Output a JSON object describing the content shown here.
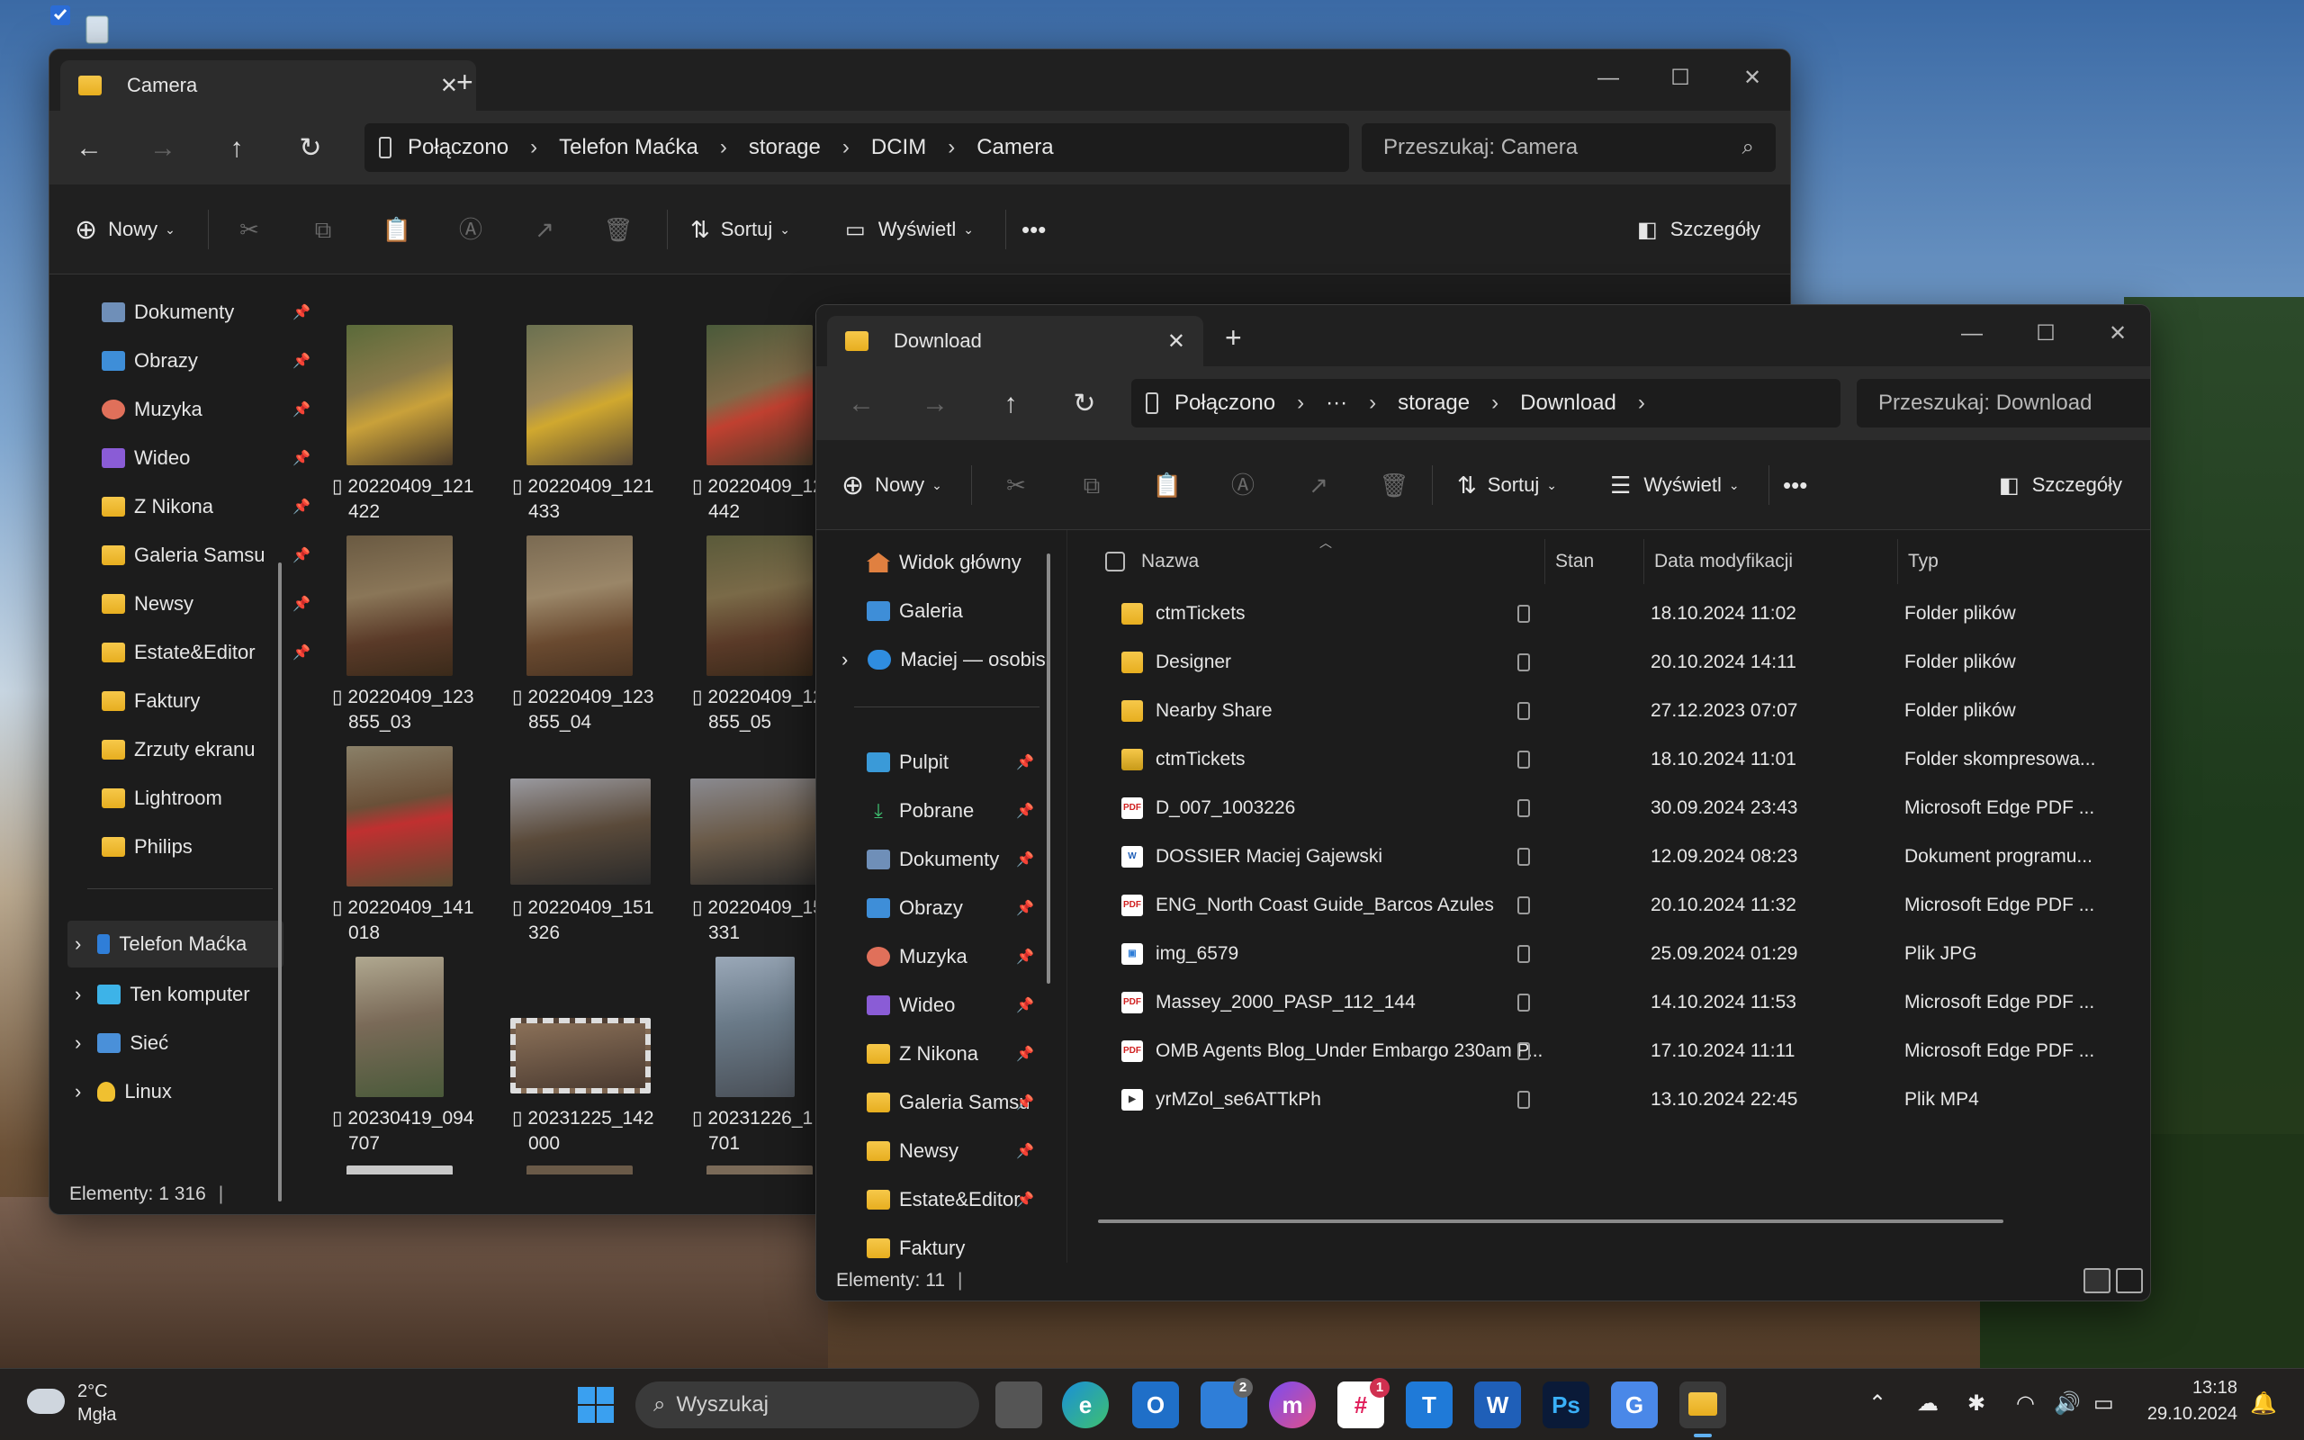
{
  "desktop": {
    "recycle_icon": "recycle-bin-icon"
  },
  "camera_window": {
    "tab_title": "Camera",
    "path": [
      "Połączono",
      "Telefon Maćka",
      "storage",
      "DCIM",
      "Camera"
    ],
    "search_placeholder": "Przeszukaj: Camera",
    "toolbar": {
      "new": "Nowy",
      "sort": "Sortuj",
      "view": "Wyświetl",
      "details": "Szczegóły",
      "more": "•••"
    },
    "sidebar": [
      {
        "label": "Dokumenty",
        "pinned": true
      },
      {
        "label": "Obrazy",
        "pinned": true
      },
      {
        "label": "Muzyka",
        "pinned": true
      },
      {
        "label": "Wideo",
        "pinned": true
      },
      {
        "label": "Z Nikona",
        "pinned": true
      },
      {
        "label": "Galeria Samsu",
        "pinned": true
      },
      {
        "label": "Newsy",
        "pinned": true
      },
      {
        "label": "Estate&Editor",
        "pinned": true
      },
      {
        "label": "Faktury",
        "pinned": false
      },
      {
        "label": "Zrzuty ekranu",
        "pinned": false
      },
      {
        "label": "Lightroom",
        "pinned": false
      },
      {
        "label": "Philips",
        "pinned": false
      }
    ],
    "sidebar_tree": [
      {
        "label": "Telefon Maćka"
      },
      {
        "label": "Ten komputer"
      },
      {
        "label": "Sieć"
      },
      {
        "label": "Linux"
      }
    ],
    "thumbnails": [
      {
        "l1": "20220409_121",
        "l2": "422"
      },
      {
        "l1": "20220409_121",
        "l2": "433"
      },
      {
        "l1": "20220409_12",
        "l2": "442"
      },
      {
        "l1": "20220409_123",
        "l2": "855_03"
      },
      {
        "l1": "20220409_123",
        "l2": "855_04"
      },
      {
        "l1": "20220409_12",
        "l2": "855_05"
      },
      {
        "l1": "20220409_141",
        "l2": "018"
      },
      {
        "l1": "20220409_151",
        "l2": "326"
      },
      {
        "l1": "20220409_15",
        "l2": "331"
      },
      {
        "l1": "20230419_094",
        "l2": "707"
      },
      {
        "l1": "20231225_142",
        "l2": "000"
      },
      {
        "l1": "20231226_1",
        "l2": "701"
      }
    ],
    "status": "Elementy: 1 316"
  },
  "download_window": {
    "tab_title": "Download",
    "path": [
      "Połączono",
      "···",
      "storage",
      "Download"
    ],
    "search_placeholder": "Przeszukaj: Download",
    "toolbar": {
      "new": "Nowy",
      "sort": "Sortuj",
      "view": "Wyświetl",
      "details": "Szczegóły",
      "more": "•••"
    },
    "sidebar_top": [
      {
        "label": "Widok główny"
      },
      {
        "label": "Galeria"
      },
      {
        "label": "Maciej — osobis"
      }
    ],
    "sidebar": [
      {
        "label": "Pulpit"
      },
      {
        "label": "Pobrane"
      },
      {
        "label": "Dokumenty"
      },
      {
        "label": "Obrazy"
      },
      {
        "label": "Muzyka"
      },
      {
        "label": "Wideo"
      },
      {
        "label": "Z Nikona"
      },
      {
        "label": "Galeria Samsu"
      },
      {
        "label": "Newsy"
      },
      {
        "label": "Estate&Editor"
      },
      {
        "label": "Faktury"
      }
    ],
    "columns": {
      "name": "Nazwa",
      "state": "Stan",
      "date": "Data modyfikacji",
      "type": "Typ"
    },
    "files": [
      {
        "name": "ctmTickets",
        "date": "18.10.2024 11:02",
        "type": "Folder plików",
        "kind": "folder"
      },
      {
        "name": "Designer",
        "date": "20.10.2024 14:11",
        "type": "Folder plików",
        "kind": "folder"
      },
      {
        "name": "Nearby Share",
        "date": "27.12.2023 07:07",
        "type": "Folder plików",
        "kind": "folder"
      },
      {
        "name": "ctmTickets",
        "date": "18.10.2024 11:01",
        "type": "Folder skompresowa...",
        "kind": "zip"
      },
      {
        "name": "D_007_1003226",
        "date": "30.09.2024 23:43",
        "type": "Microsoft Edge PDF ...",
        "kind": "pdf"
      },
      {
        "name": "DOSSIER Maciej Gajewski",
        "date": "12.09.2024 08:23",
        "type": "Dokument programu...",
        "kind": "word"
      },
      {
        "name": "ENG_North Coast Guide_Barcos Azules",
        "date": "20.10.2024 11:32",
        "type": "Microsoft Edge PDF ...",
        "kind": "pdf"
      },
      {
        "name": "img_6579",
        "date": "25.09.2024 01:29",
        "type": "Plik JPG",
        "kind": "jpg"
      },
      {
        "name": "Massey_2000_PASP_112_144",
        "date": "14.10.2024 11:53",
        "type": "Microsoft Edge PDF ...",
        "kind": "pdf"
      },
      {
        "name": "OMB Agents Blog_Under Embargo 230am P...",
        "date": "17.10.2024 11:11",
        "type": "Microsoft Edge PDF ...",
        "kind": "pdf"
      },
      {
        "name": "yrMZol_se6ATTkPh",
        "date": "13.10.2024 22:45",
        "type": "Plik MP4",
        "kind": "mp4"
      }
    ],
    "status": "Elementy: 11"
  },
  "taskbar": {
    "weather_temp": "2°C",
    "weather_desc": "Mgła",
    "search_placeholder": "Wyszukaj",
    "apps": [
      {
        "name": "task-view",
        "label": ""
      },
      {
        "name": "edge",
        "label": "e"
      },
      {
        "name": "outlook",
        "label": "O"
      },
      {
        "name": "store",
        "label": "",
        "badge": "2"
      },
      {
        "name": "messenger",
        "label": "m"
      },
      {
        "name": "slack",
        "label": "#",
        "badge": "1"
      },
      {
        "name": "trello",
        "label": "T"
      },
      {
        "name": "word",
        "label": "W"
      },
      {
        "name": "photoshop",
        "label": "Ps"
      },
      {
        "name": "translate",
        "label": "G"
      },
      {
        "name": "explorer",
        "label": ""
      }
    ],
    "time": "13:18",
    "date": "29.10.2024"
  }
}
